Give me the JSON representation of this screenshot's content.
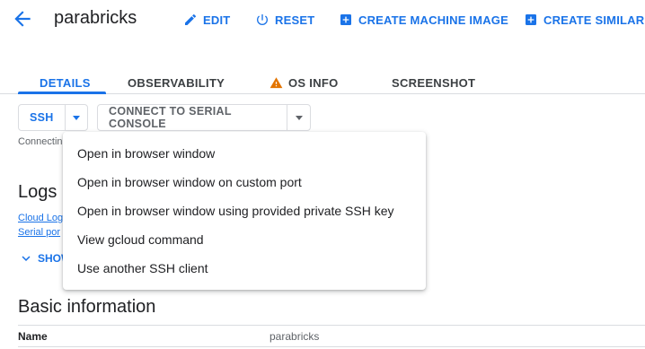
{
  "header": {
    "title": "parabricks",
    "actions": {
      "edit": "EDIT",
      "reset": "RESET",
      "create_image": "CREATE MACHINE IMAGE",
      "create_similar": "CREATE SIMILAR"
    }
  },
  "tabs": [
    {
      "label": "DETAILS",
      "active": true
    },
    {
      "label": "OBSERVABILITY",
      "active": false
    },
    {
      "label": "OS INFO",
      "active": false,
      "icon": "warning-icon"
    },
    {
      "label": "SCREENSHOT",
      "active": false
    }
  ],
  "toolbar": {
    "ssh_label": "SSH",
    "serial_label": "CONNECT TO SERIAL CONSOLE"
  },
  "status_text": "Connectin",
  "logs": {
    "title": "Logs",
    "cloud_link": "Cloud Log",
    "serial_link": "Serial por",
    "show_more": "SHOW"
  },
  "ssh_menu": {
    "items": [
      "Open in browser window",
      "Open in browser window on custom port",
      "Open in browser window using provided private SSH key",
      "View gcloud command",
      "Use another SSH client"
    ]
  },
  "basic_info": {
    "title": "Basic information",
    "rows": [
      {
        "label": "Name",
        "value": "parabricks"
      }
    ]
  },
  "colors": {
    "accent": "#1a73e8",
    "warning": "#e37400",
    "divider": "#dadce0",
    "disabled_text": "#5f6368"
  }
}
